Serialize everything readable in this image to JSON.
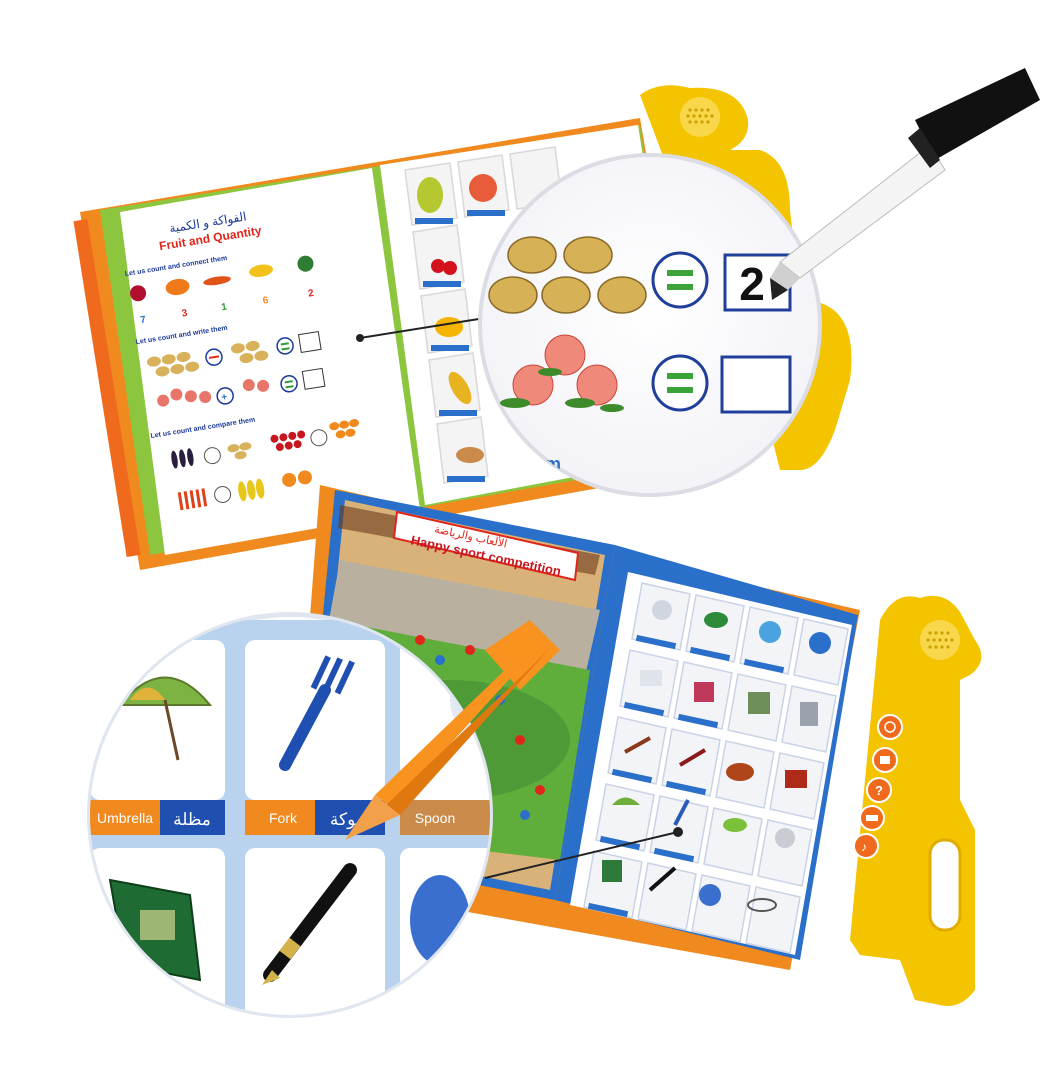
{
  "top_book": {
    "title_ar": "الفواكة و الكمية",
    "title_en": "Fruit and Quantity",
    "instruction_1": "Let us count and connect them",
    "numbers": [
      "7",
      "3",
      "1",
      "6",
      "2"
    ],
    "instruction_2": "Let us count and write them",
    "instruction_3": "Let us count and compare them",
    "zoom_answer": "2"
  },
  "bottom_book": {
    "banner_ar": "الألعاب والرياضة",
    "banner_en": "Happy sport competition"
  },
  "zoom_bottom": {
    "item_1_en": "Umbrella",
    "item_1_ar": "مظلة",
    "item_2_en": "Fork",
    "item_2_ar": "شوكة",
    "item_3_en": "Spoon"
  },
  "colors": {
    "toy_yellow": "#f5c400",
    "toy_orange": "#f08a1e",
    "page_blue": "#2a6fc9",
    "pen_orange": "#f7931e"
  },
  "icons": [
    "speaker-icon",
    "power-icon",
    "mode-icon",
    "question-icon",
    "volume-icon",
    "music-icon"
  ]
}
